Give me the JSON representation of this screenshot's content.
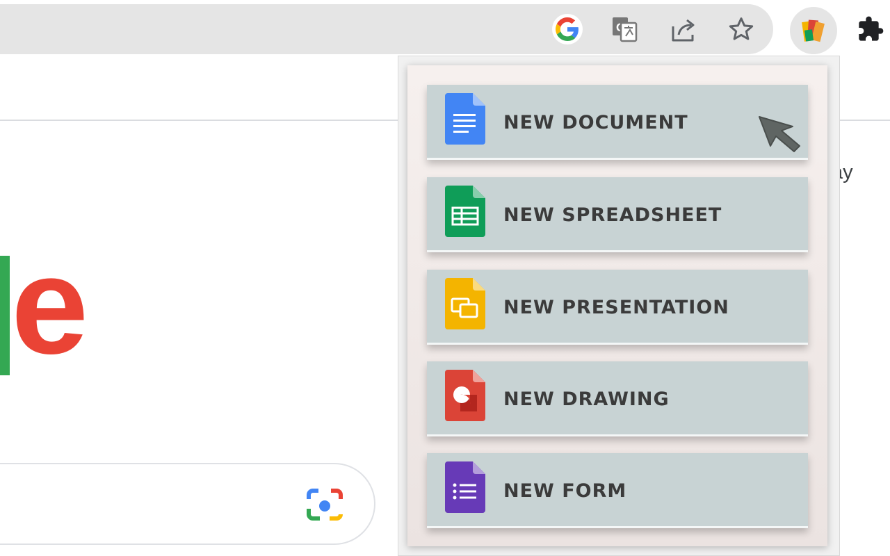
{
  "toolbar": {
    "icons": [
      "google-g-icon",
      "translate-icon",
      "share-icon",
      "bookmark-star-icon",
      "google-docs-extension-icon",
      "extensions-puzzle-icon"
    ]
  },
  "page": {
    "logo_fragment": "le",
    "aside_text_fragment": "ay",
    "search_icons": [
      "google-lens-icon"
    ]
  },
  "colors": {
    "docs_blue": "#4285f4",
    "sheets_green": "#0f9d58",
    "slides_yellow": "#f4b400",
    "drawings_red": "#db4437",
    "forms_purple": "#673ab7",
    "menu_item_bg": "#c8d3d4",
    "logo_green": "#34a853",
    "logo_red": "#ea4335"
  },
  "menu": {
    "items": [
      {
        "label": "NEW DOCUMENT",
        "icon": "google-docs-icon"
      },
      {
        "label": "NEW SPREADSHEET",
        "icon": "google-sheets-icon"
      },
      {
        "label": "NEW PRESENTATION",
        "icon": "google-slides-icon"
      },
      {
        "label": "NEW DRAWING",
        "icon": "google-drawings-icon"
      },
      {
        "label": "NEW FORM",
        "icon": "google-forms-icon"
      }
    ]
  }
}
